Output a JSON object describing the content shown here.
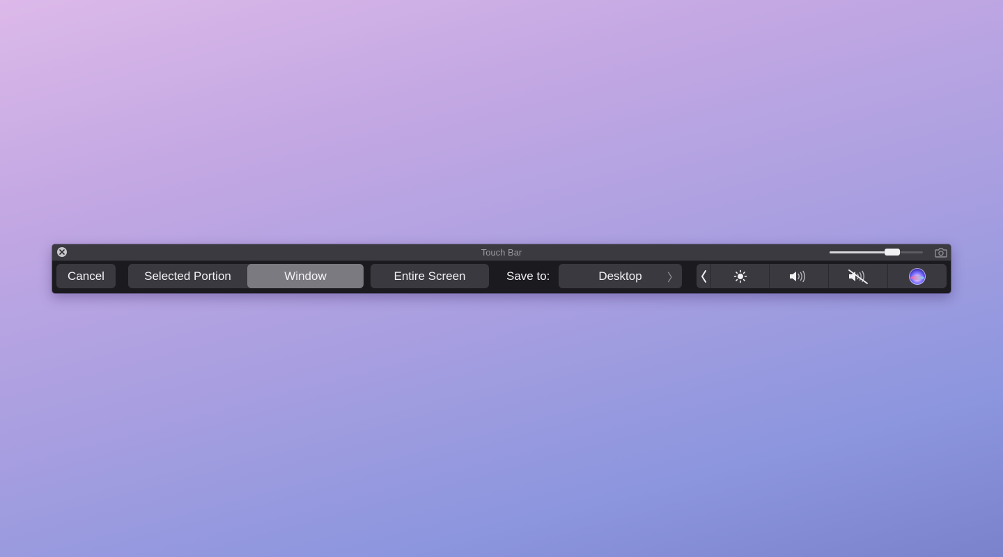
{
  "window": {
    "title": "Touch Bar",
    "zoom_level": 0.67
  },
  "controls": {
    "cancel_label": "Cancel",
    "modes": [
      {
        "label": "Selected Portion",
        "selected": false
      },
      {
        "label": "Window",
        "selected": true
      },
      {
        "label": "Entire Screen",
        "selected": false
      }
    ],
    "save_to_label": "Save to:",
    "save_location": "Desktop",
    "save_location_chevron": "〉"
  },
  "control_strip": {
    "expand_chevron": "〈",
    "items": [
      {
        "icon": "brightness-icon"
      },
      {
        "icon": "volume-icon"
      },
      {
        "icon": "mute-icon"
      },
      {
        "icon": "siri-icon"
      }
    ]
  },
  "colors": {
    "bar_bg": "#1b1b1f",
    "button_bg": "#3a393f",
    "selected_bg": "#7b7a80",
    "titlebar_bg": "#3b3a40"
  }
}
